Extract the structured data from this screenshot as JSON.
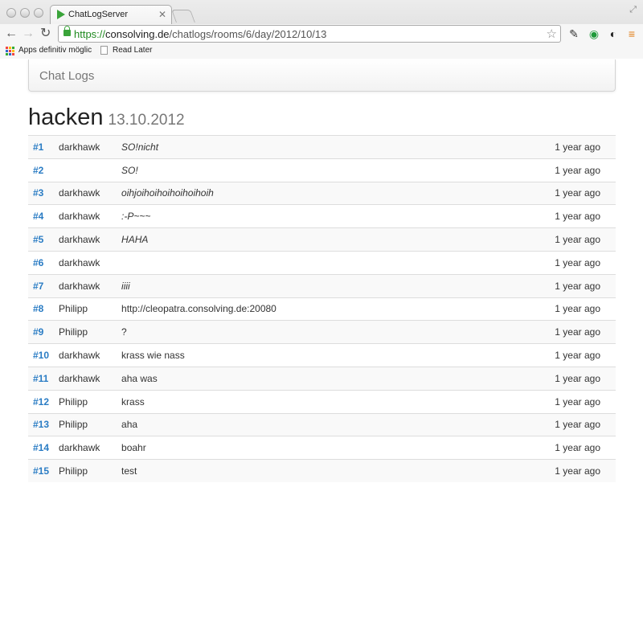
{
  "browser": {
    "tab_title": "ChatLogServer",
    "url_scheme": "https://",
    "url_host": "consolving.de",
    "url_path": "/chatlogs/rooms/6/day/2012/10/13",
    "bookmarks": [
      {
        "label": "Apps definitiv möglic"
      },
      {
        "label": "Read Later"
      }
    ]
  },
  "navbar": {
    "brand": "Chat Logs"
  },
  "page": {
    "room": "hacken",
    "date": "13.10.2012"
  },
  "log": [
    {
      "id": "#1",
      "user": "darkhawk",
      "message": "SO!nicht",
      "italic": true,
      "time": "1 year ago"
    },
    {
      "id": "#2",
      "user": "",
      "message": "SO!",
      "italic": true,
      "time": "1 year ago"
    },
    {
      "id": "#3",
      "user": "darkhawk",
      "message": "oihjoihoihoihoihoihoih",
      "italic": true,
      "time": "1 year ago"
    },
    {
      "id": "#4",
      "user": "darkhawk",
      "message": ":-P~~~",
      "italic": true,
      "time": "1 year ago"
    },
    {
      "id": "#5",
      "user": "darkhawk",
      "message": "HAHA",
      "italic": true,
      "time": "1 year ago"
    },
    {
      "id": "#6",
      "user": "darkhawk",
      "message": "",
      "italic": true,
      "time": "1 year ago"
    },
    {
      "id": "#7",
      "user": "darkhawk",
      "message": "iiii",
      "italic": true,
      "time": "1 year ago"
    },
    {
      "id": "#8",
      "user": "Philipp",
      "message": "http://cleopatra.consolving.de:20080",
      "italic": false,
      "time": "1 year ago"
    },
    {
      "id": "#9",
      "user": "Philipp",
      "message": "?",
      "italic": false,
      "time": "1 year ago"
    },
    {
      "id": "#10",
      "user": "darkhawk",
      "message": "krass wie nass",
      "italic": false,
      "time": "1 year ago"
    },
    {
      "id": "#11",
      "user": "darkhawk",
      "message": "aha was",
      "italic": false,
      "time": "1 year ago"
    },
    {
      "id": "#12",
      "user": "Philipp",
      "message": "krass",
      "italic": false,
      "time": "1 year ago"
    },
    {
      "id": "#13",
      "user": "Philipp",
      "message": "aha",
      "italic": false,
      "time": "1 year ago"
    },
    {
      "id": "#14",
      "user": "darkhawk",
      "message": "boahr",
      "italic": false,
      "time": "1 year ago"
    },
    {
      "id": "#15",
      "user": "Philipp",
      "message": "test",
      "italic": false,
      "time": "1 year ago"
    }
  ],
  "colors": {
    "link": "#2a7cc4",
    "secure_scheme": "#1f8a1f",
    "row_stripe": "#f9f9f9"
  }
}
